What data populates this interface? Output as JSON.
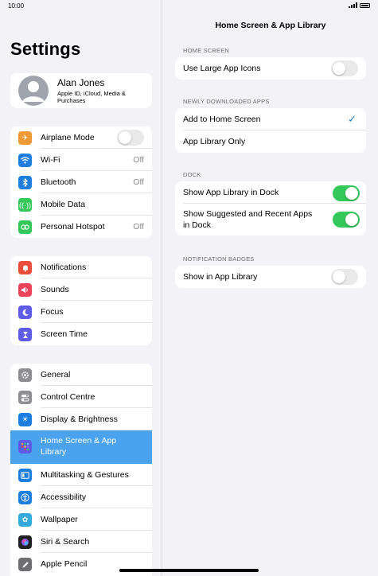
{
  "status": {
    "time": "10:00"
  },
  "sidebar": {
    "title": "Settings",
    "profile": {
      "name": "Alan Jones",
      "subtitle": "Apple ID, iCloud, Media & Purchases"
    },
    "group1": [
      {
        "label": "Airplane Mode",
        "icon": "airplane-icon",
        "color": "#f09a37",
        "toggle": false
      },
      {
        "label": "Wi-Fi",
        "icon": "wifi-icon",
        "color": "#1e7ee0",
        "value": "Off"
      },
      {
        "label": "Bluetooth",
        "icon": "bluetooth-icon",
        "color": "#1e7ee0",
        "value": "Off"
      },
      {
        "label": "Mobile Data",
        "icon": "antenna-icon",
        "color": "#34c759"
      },
      {
        "label": "Personal Hotspot",
        "icon": "hotspot-icon",
        "color": "#34c759",
        "value": "Off"
      }
    ],
    "group2": [
      {
        "label": "Notifications",
        "icon": "bell-icon",
        "color": "#eb4d3d"
      },
      {
        "label": "Sounds",
        "icon": "speaker-icon",
        "color": "#eb445a"
      },
      {
        "label": "Focus",
        "icon": "moon-icon",
        "color": "#5e5ce6"
      },
      {
        "label": "Screen Time",
        "icon": "hourglass-icon",
        "color": "#5e5ce6"
      }
    ],
    "group3": [
      {
        "label": "General",
        "icon": "gear-icon",
        "color": "#8e8e93"
      },
      {
        "label": "Control Centre",
        "icon": "switches-icon",
        "color": "#8e8e93"
      },
      {
        "label": "Display & Brightness",
        "icon": "sun-icon",
        "color": "#1e7ee0"
      },
      {
        "label": "Home Screen & App Library",
        "icon": "grid-icon",
        "color": "#5e5ce6",
        "selected": true
      },
      {
        "label": "Multitasking & Gestures",
        "icon": "multitask-icon",
        "color": "#1e7ee0"
      },
      {
        "label": "Accessibility",
        "icon": "accessibility-icon",
        "color": "#1e7ee0"
      },
      {
        "label": "Wallpaper",
        "icon": "flower-icon",
        "color": "#34aadc"
      },
      {
        "label": "Siri & Search",
        "icon": "siri-icon",
        "color": "#222222"
      },
      {
        "label": "Apple Pencil",
        "icon": "pencil-icon",
        "color": "#6d6d72"
      }
    ]
  },
  "main": {
    "title": "Home Screen & App Library",
    "sections": {
      "home_screen": {
        "header": "HOME SCREEN",
        "rows": [
          {
            "label": "Use Large App Icons",
            "toggle": false
          }
        ]
      },
      "newly_downloaded": {
        "header": "NEWLY DOWNLOADED APPS",
        "rows": [
          {
            "label": "Add to Home Screen",
            "checked": true
          },
          {
            "label": "App Library Only",
            "checked": false
          }
        ]
      },
      "dock": {
        "header": "DOCK",
        "rows": [
          {
            "label": "Show App Library in Dock",
            "toggle": true
          },
          {
            "label": "Show Suggested and Recent Apps in Dock",
            "toggle": true
          }
        ]
      },
      "badges": {
        "header": "NOTIFICATION BADGES",
        "rows": [
          {
            "label": "Show in App Library",
            "toggle": false
          }
        ]
      }
    },
    "check_glyph": "✓"
  },
  "colors": {
    "accent": "#1e7ee0",
    "selected_row": "#4ba3f0",
    "toggle_on": "#34c759"
  }
}
